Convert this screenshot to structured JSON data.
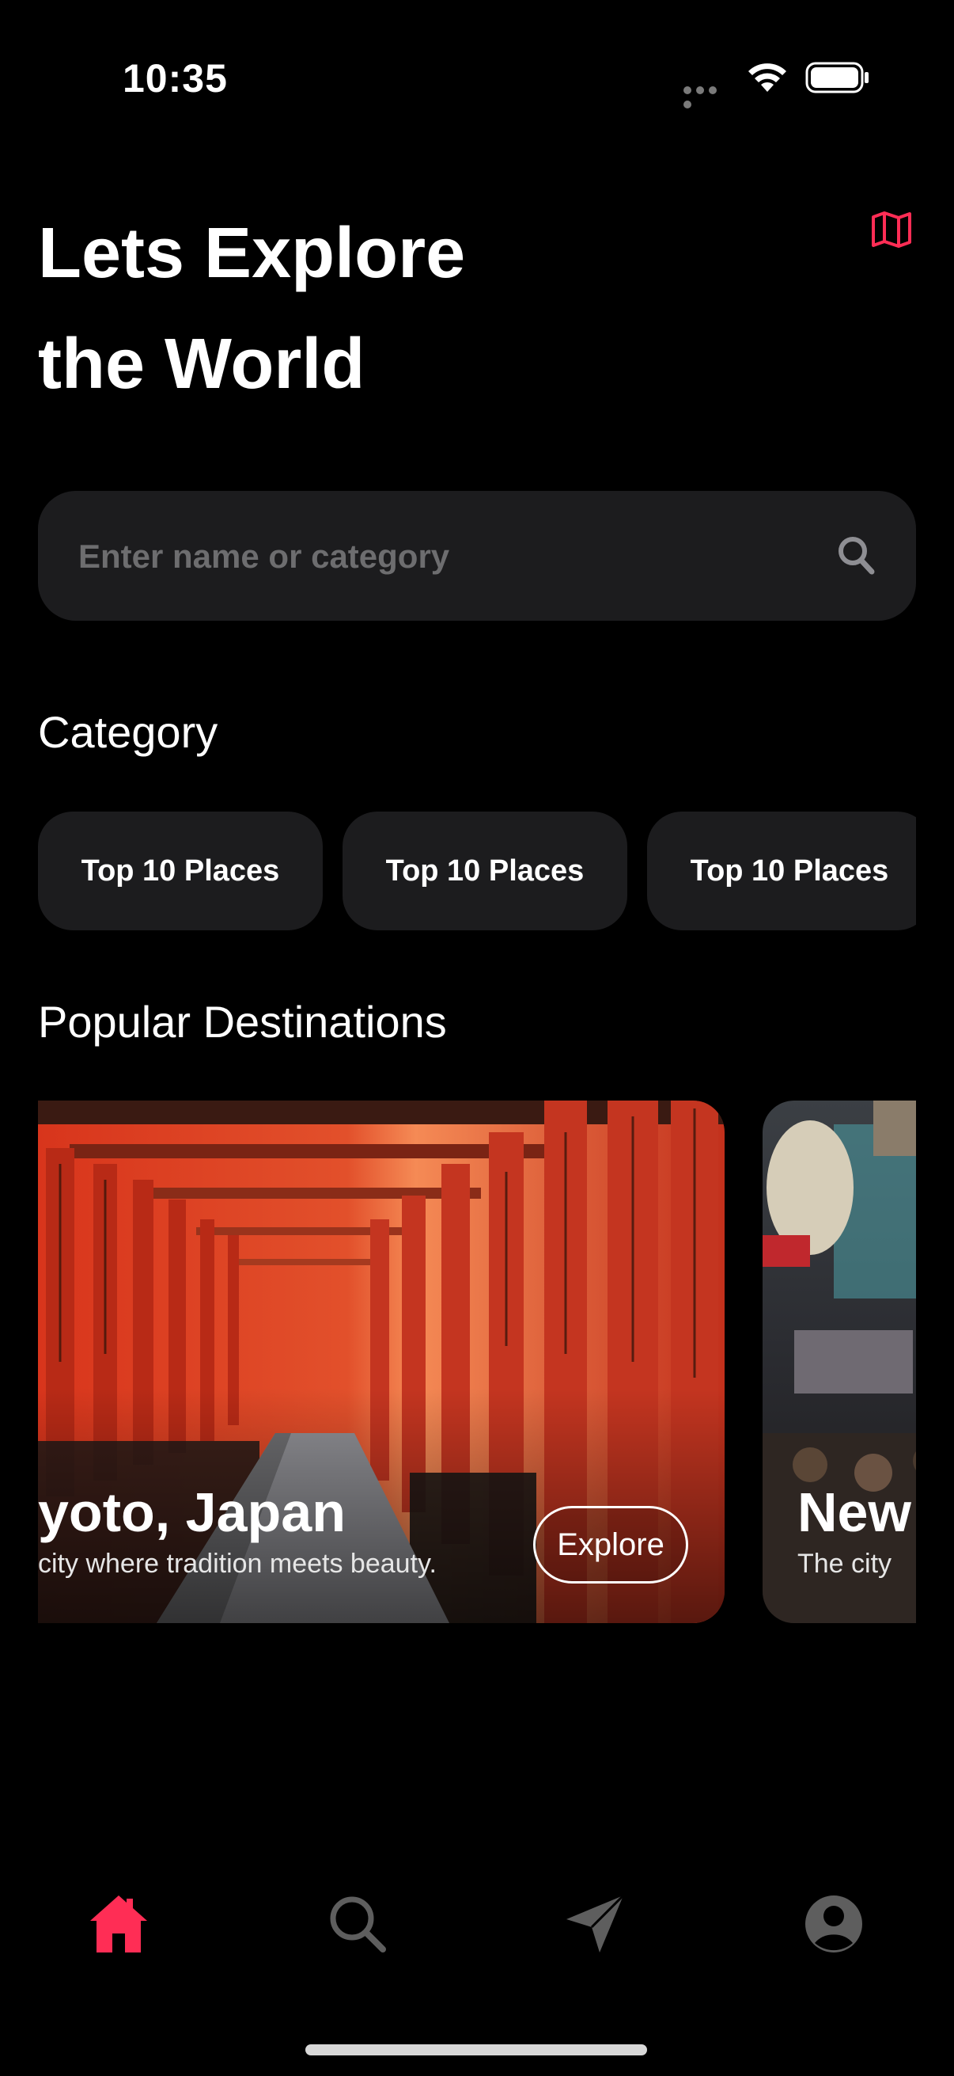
{
  "status_bar": {
    "time": "10:35"
  },
  "header": {
    "title_line1": "Lets Explore",
    "title_line2": "the World",
    "map_icon": "map-icon"
  },
  "search": {
    "placeholder": "Enter name or category",
    "value": ""
  },
  "category": {
    "title": "Category",
    "chips": [
      {
        "label": "Top 10 Places"
      },
      {
        "label": "Top 10 Places"
      },
      {
        "label": "Top 10 Places"
      }
    ]
  },
  "popular": {
    "title": "Popular Destinations",
    "cards": [
      {
        "title": "yoto, Japan",
        "description": "city where tradition meets beauty.",
        "button": "Explore"
      },
      {
        "title": "New",
        "description": "The city"
      }
    ]
  },
  "tabbar": {
    "items": [
      {
        "icon": "home-icon",
        "active": true
      },
      {
        "icon": "search-icon",
        "active": false
      },
      {
        "icon": "send-icon",
        "active": false
      },
      {
        "icon": "profile-icon",
        "active": false
      }
    ]
  },
  "colors": {
    "accent": "#ff2d55",
    "surface": "#1c1c1e",
    "inactive": "#5e5e5e",
    "background": "#000000"
  }
}
